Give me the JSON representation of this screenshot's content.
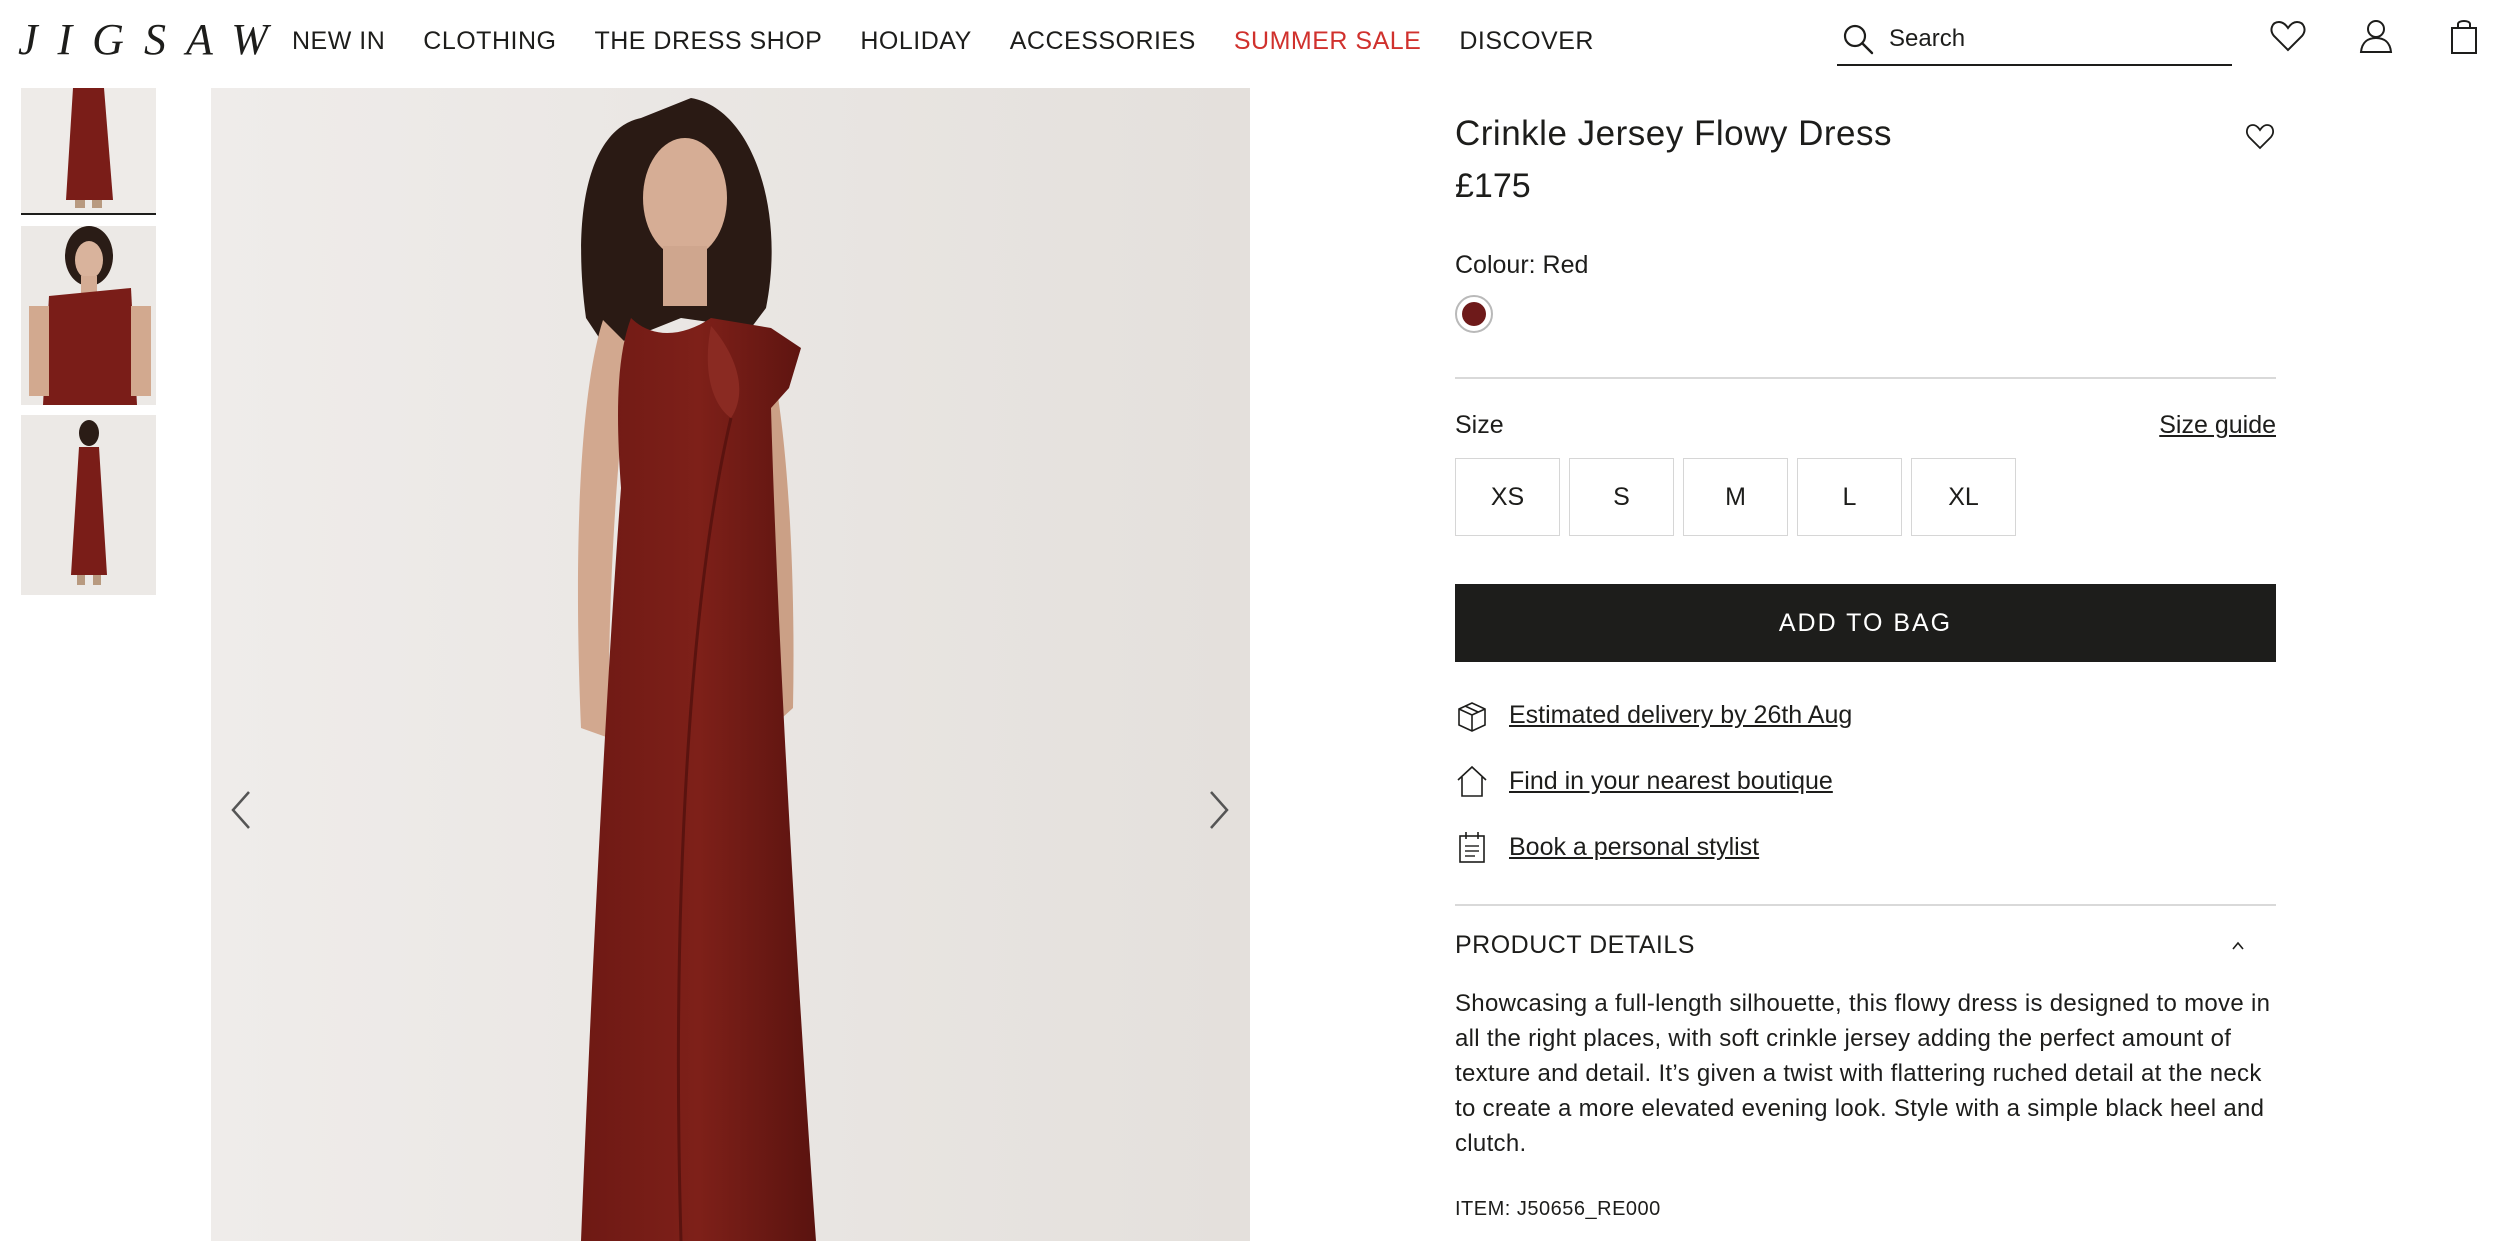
{
  "brand": {
    "logo_text": "JIGSAW"
  },
  "nav": {
    "items": [
      {
        "label": "NEW IN"
      },
      {
        "label": "CLOTHING"
      },
      {
        "label": "THE DRESS SHOP"
      },
      {
        "label": "HOLIDAY"
      },
      {
        "label": "ACCESSORIES"
      },
      {
        "label": "SUMMER SALE"
      },
      {
        "label": "DISCOVER"
      }
    ],
    "sale_color": "#d0312d"
  },
  "search": {
    "placeholder": "Search",
    "icon": "search-icon"
  },
  "header_icons": [
    "heart-icon",
    "account-icon",
    "bag-icon"
  ],
  "gallery": {
    "thumbnails": [
      "front-full-length",
      "front-detail",
      "back-full-length"
    ],
    "active_thumbnail": 0,
    "prev_icon": "chevron-left-icon",
    "next_icon": "chevron-right-icon"
  },
  "product": {
    "title": "Crinkle Jersey Flowy Dress",
    "price": "£175",
    "colour_label": "Colour: Red",
    "swatch_color": "#6e1a1a",
    "size_label": "Size",
    "size_guide": "Size guide",
    "sizes": [
      "XS",
      "S",
      "M",
      "L",
      "XL"
    ],
    "add_to_bag": "ADD TO BAG",
    "delivery": "Estimated delivery by 26th Aug",
    "boutique": "Find in your nearest boutique",
    "stylist": "Book a personal stylist",
    "details_heading": "PRODUCT DETAILS",
    "description": "Showcasing a full-length silhouette, this flowy dress is designed to move in all the right places, with soft crinkle jersey adding the perfect amount of texture and detail. It’s given a twist with flattering ruched detail at the neck to create a more elevated evening look. Style with a simple black heel and clutch.",
    "item_code": "ITEM: J50656_RE000"
  }
}
